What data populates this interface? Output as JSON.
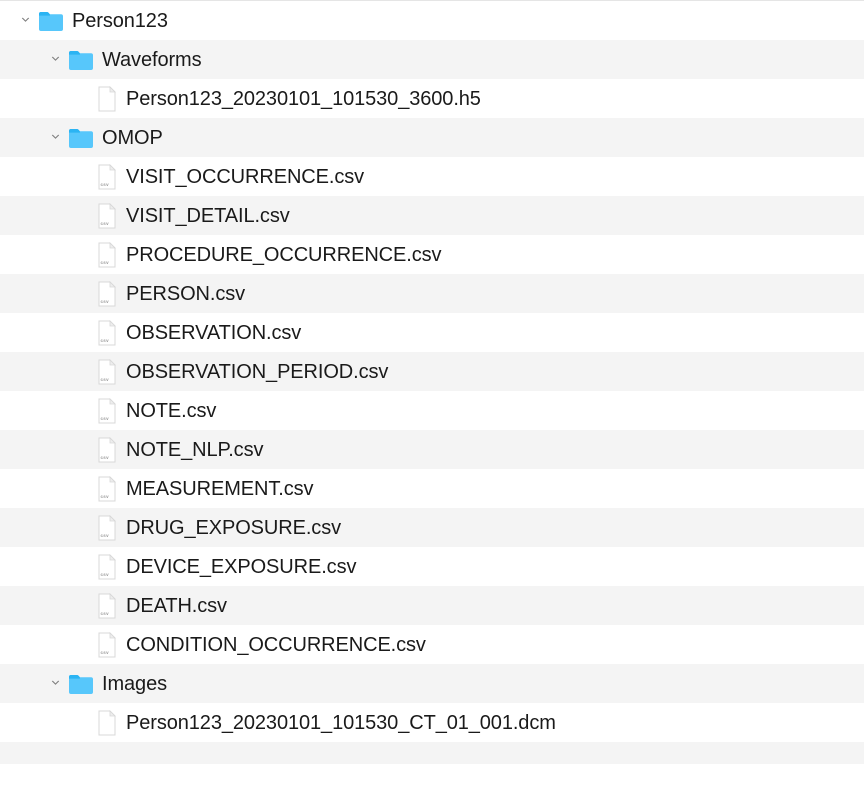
{
  "tree": {
    "root": {
      "name": "Person123",
      "type": "folder",
      "expanded": true,
      "depth": 0,
      "children": [
        {
          "name": "Waveforms",
          "type": "folder",
          "expanded": true,
          "depth": 1,
          "children": [
            {
              "name": "Person123_20230101_101530_3600.h5",
              "type": "file",
              "ext": "h5",
              "depth": 2
            }
          ]
        },
        {
          "name": "OMOP",
          "type": "folder",
          "expanded": true,
          "depth": 1,
          "children": [
            {
              "name": "VISIT_OCCURRENCE.csv",
              "type": "file",
              "ext": "csv",
              "depth": 2
            },
            {
              "name": "VISIT_DETAIL.csv",
              "type": "file",
              "ext": "csv",
              "depth": 2
            },
            {
              "name": "PROCEDURE_OCCURRENCE.csv",
              "type": "file",
              "ext": "csv",
              "depth": 2
            },
            {
              "name": "PERSON.csv",
              "type": "file",
              "ext": "csv",
              "depth": 2
            },
            {
              "name": "OBSERVATION.csv",
              "type": "file",
              "ext": "csv",
              "depth": 2
            },
            {
              "name": "OBSERVATION_PERIOD.csv",
              "type": "file",
              "ext": "csv",
              "depth": 2
            },
            {
              "name": "NOTE.csv",
              "type": "file",
              "ext": "csv",
              "depth": 2
            },
            {
              "name": "NOTE_NLP.csv",
              "type": "file",
              "ext": "csv",
              "depth": 2
            },
            {
              "name": "MEASUREMENT.csv",
              "type": "file",
              "ext": "csv",
              "depth": 2
            },
            {
              "name": "DRUG_EXPOSURE.csv",
              "type": "file",
              "ext": "csv",
              "depth": 2
            },
            {
              "name": "DEVICE_EXPOSURE.csv",
              "type": "file",
              "ext": "csv",
              "depth": 2
            },
            {
              "name": "DEATH.csv",
              "type": "file",
              "ext": "csv",
              "depth": 2
            },
            {
              "name": "CONDITION_OCCURRENCE.csv",
              "type": "file",
              "ext": "csv",
              "depth": 2
            }
          ]
        },
        {
          "name": "Images",
          "type": "folder",
          "expanded": true,
          "depth": 1,
          "children": [
            {
              "name": "Person123_20230101_101530_CT_01_001.dcm",
              "type": "file",
              "ext": "dcm",
              "depth": 2
            }
          ]
        }
      ]
    }
  },
  "colors": {
    "folder_fill": "#4fc3f7",
    "folder_top": "#29b6f6",
    "row_alt": "#f4f4f4",
    "row_even": "#ffffff",
    "text": "#1a1a1a",
    "chevron": "#7d7d7d",
    "file_border": "#d5d5d5",
    "file_fill": "#ffffff"
  },
  "icon_labels": {
    "csv": "csv"
  }
}
